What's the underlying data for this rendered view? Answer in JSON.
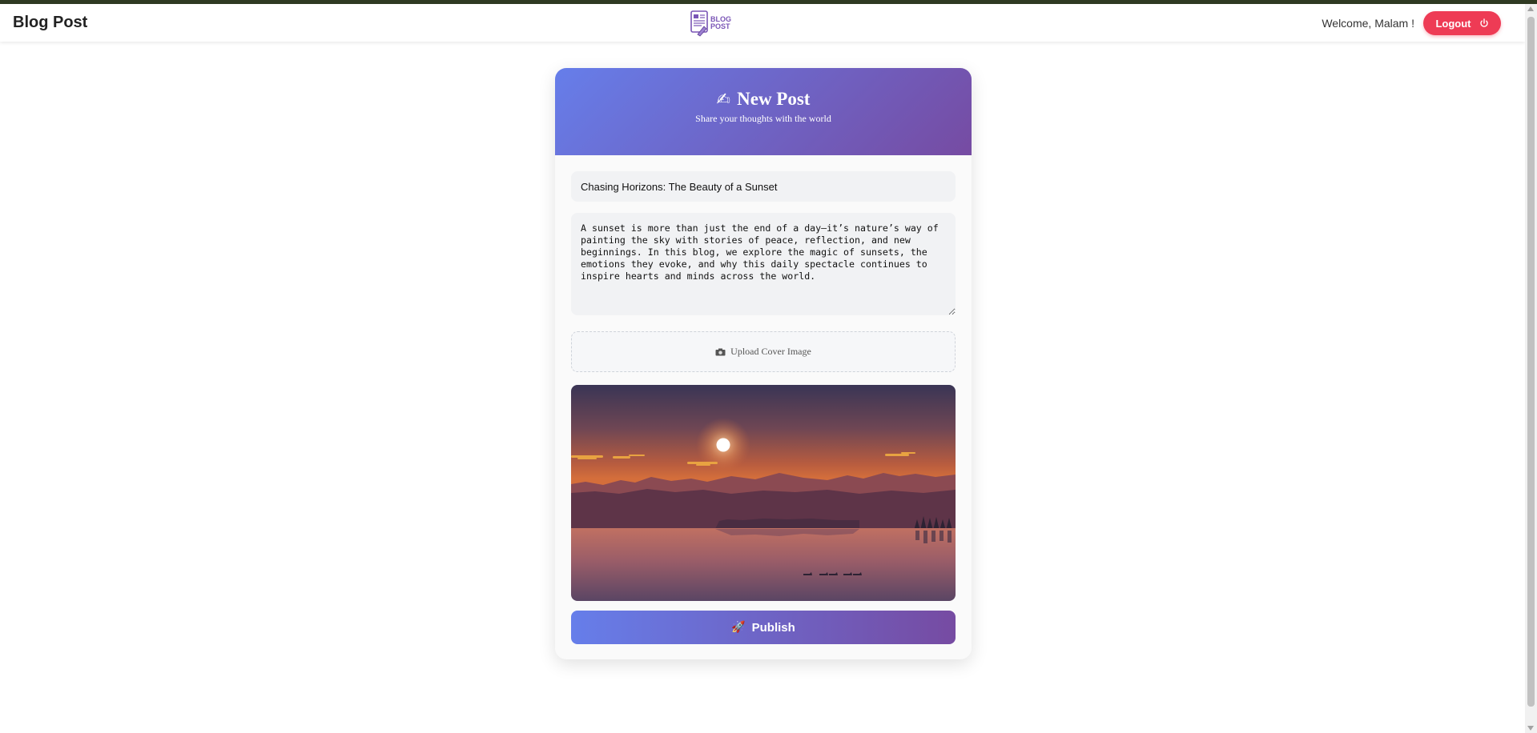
{
  "navbar": {
    "brand": "Blog Post",
    "logo_text_top": "BLOG",
    "logo_text_bottom": "POST",
    "welcome": "Welcome, Malam !",
    "logout_label": "Logout"
  },
  "card": {
    "title": "New Post",
    "subtitle": "Share your thoughts with the world",
    "title_input_value": "Chasing Horizons: The Beauty of a Sunset",
    "content_value": "A sunset is more than just the end of a day—it’s nature’s way of painting the sky with stories of peace, reflection, and new beginnings. In this blog, we explore the magic of sunsets, the emotions they evoke, and why this daily spectacle continues to inspire hearts and minds across the world.",
    "upload_label": "Upload Cover Image",
    "publish_label": "Publish"
  },
  "icons": {
    "title_icon": "writing-hand-icon",
    "upload_icon": "camera-icon",
    "publish_icon": "rocket-icon",
    "logout_icon": "power-icon"
  },
  "colors": {
    "accent_start": "#667eea",
    "accent_end": "#764ba2",
    "logout": "#ee3b55"
  }
}
